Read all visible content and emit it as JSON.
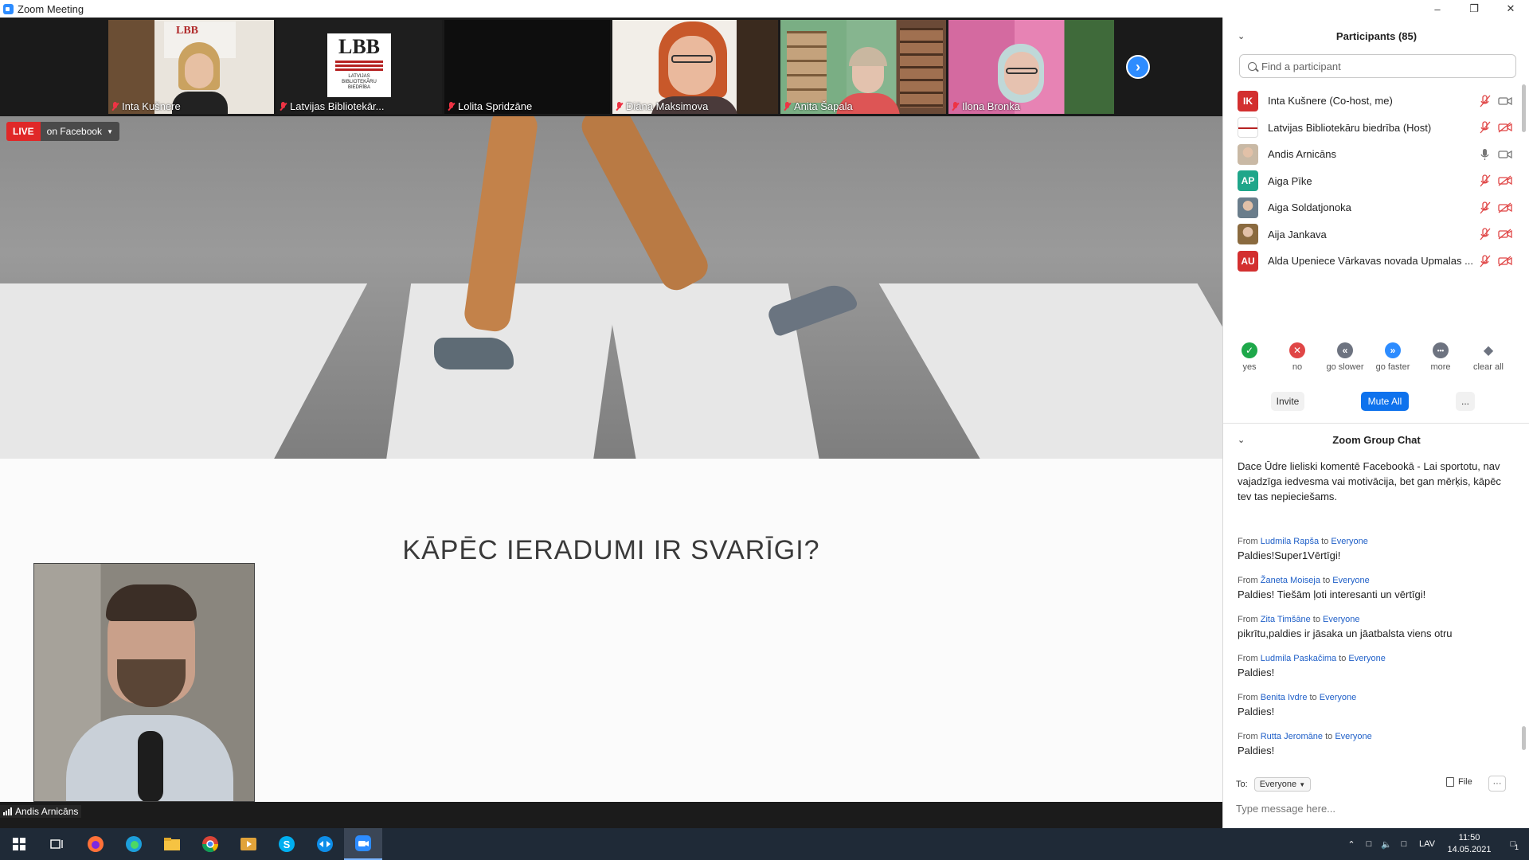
{
  "window": {
    "title": "Zoom Meeting"
  },
  "thumbnails": [
    {
      "name": "Inta Kušnere",
      "muted": true,
      "scene": "photo-woman-shelf"
    },
    {
      "name": "Latvijas Bibliotekār...",
      "muted": true,
      "scene": "logo",
      "logo_text": "LBB",
      "logo_sub": "LATVIJAS BIBLIOTEKĀRU BIEDRĪBA"
    },
    {
      "name": "Lolita Spridzāne",
      "muted": true,
      "scene": "black"
    },
    {
      "name": "Diāna Maksimova",
      "muted": true,
      "scene": "photo-redhair"
    },
    {
      "name": "Anita Šapala",
      "muted": true,
      "scene": "photo-library"
    },
    {
      "name": "Ilona Bronka",
      "muted": true,
      "scene": "photo-pink"
    }
  ],
  "live": {
    "badge": "LIVE",
    "platform": "on Facebook"
  },
  "slide": {
    "title": "KĀPĒC IERADUMI IR SVARĪGI?"
  },
  "speaker": {
    "name": "Andis Arnicāns"
  },
  "participants": {
    "header": "Participants (85)",
    "search_placeholder": "Find a participant",
    "list": [
      {
        "initials": "IK",
        "name": "Inta Kušnere (Co-host, me)",
        "avatar_color": "#d32f2f",
        "mic": "muted",
        "cam": "on"
      },
      {
        "initials": "",
        "name": "Latvijas Bibliotekāru biedrība (Host)",
        "avatar_color": "#ffffff",
        "mic": "muted",
        "cam": "off",
        "avatar": "logo"
      },
      {
        "initials": "",
        "name": "Andis Arnicāns",
        "avatar_color": "#c9b9a5",
        "mic": "on",
        "cam": "on",
        "avatar": "photo"
      },
      {
        "initials": "AP",
        "name": "Aiga Pīke",
        "avatar_color": "#1fa68a",
        "mic": "muted",
        "cam": "off"
      },
      {
        "initials": "",
        "name": "Aiga Soldatjonoka",
        "avatar_color": "#6a7d8b",
        "mic": "muted",
        "cam": "off",
        "avatar": "photo"
      },
      {
        "initials": "",
        "name": "Aija Jankava",
        "avatar_color": "#8a6a3f",
        "mic": "muted",
        "cam": "off",
        "avatar": "photo"
      },
      {
        "initials": "AU",
        "name": "Alda Upeniece Vārkavas novada Upmalas ...",
        "avatar_color": "#d32f2f",
        "mic": "muted",
        "cam": "off"
      }
    ],
    "reactions": [
      {
        "label": "yes",
        "symbol": "✓",
        "color": "#1ea84a"
      },
      {
        "label": "no",
        "symbol": "✕",
        "color": "#e04646"
      },
      {
        "label": "go slower",
        "symbol": "«",
        "color": "#6d7380"
      },
      {
        "label": "go faster",
        "symbol": "»",
        "color": "#2d8cff"
      },
      {
        "label": "more",
        "symbol": "•••",
        "color": "#6d7380"
      },
      {
        "label": "clear all",
        "symbol": "◆",
        "color": "#6d7380"
      }
    ],
    "invite_label": "Invite",
    "mute_all_label": "Mute All",
    "more_label": "..."
  },
  "chat": {
    "header": "Zoom Group Chat",
    "messages": [
      {
        "from": "",
        "to": "",
        "text": "Dace Ūdre lieliski komentē Facebookā - Lai sportotu, nav vajadzīga iedvesma vai motivācija, bet gan mērķis, kāpēc tev tas nepieciešams."
      },
      {
        "from": "Ludmila Rapša",
        "to": "Everyone",
        "text": "Paldies!Super1Vērtīgi!"
      },
      {
        "from": "Žaneta Moiseja",
        "to": "Everyone",
        "text": "Paldies! Tiešām ļoti interesanti un vērtīgi!"
      },
      {
        "from": "Zita Timšāne",
        "to": "Everyone",
        "text": "pikrītu,paldies ir jāsaka un jāatbalsta viens otru"
      },
      {
        "from": "Ludmila Paskačima",
        "to": "Everyone",
        "text": "Paldies!"
      },
      {
        "from": "Benita Ivdre",
        "to": "Everyone",
        "text": "Paldies!"
      },
      {
        "from": "Rutta Jeromāne",
        "to": "Everyone",
        "text": "Paldies!"
      }
    ],
    "from_word": "From",
    "to_word": "to",
    "to_label": "To:",
    "recipient": "Everyone",
    "file_label": "File",
    "more_label": "···",
    "input_placeholder": "Type message here..."
  },
  "taskbar": {
    "apps": [
      "windows-start",
      "task-view",
      "firefox",
      "edge",
      "file-explorer",
      "chrome",
      "media-player",
      "skype",
      "teamviewer",
      "zoom"
    ],
    "language": "LAV",
    "time": "11:50",
    "date": "14.05.2021",
    "notification_count": "1"
  }
}
